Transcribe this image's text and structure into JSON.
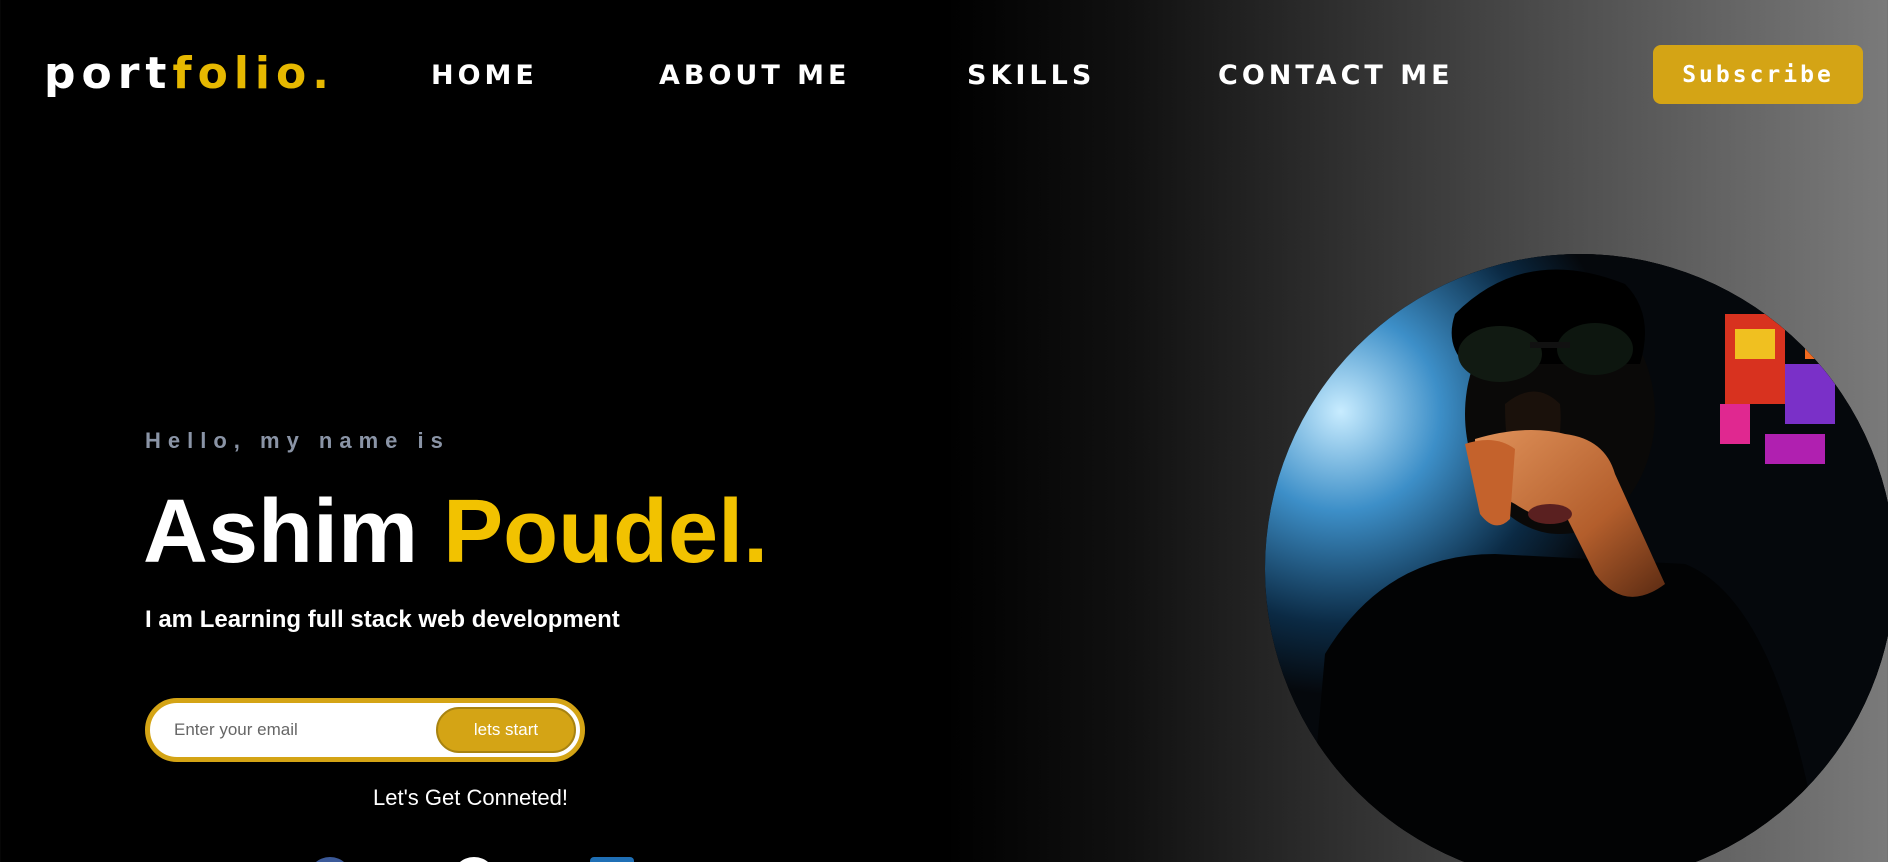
{
  "header": {
    "logo_part1": "port",
    "logo_part2": "folio.",
    "nav": [
      {
        "label": "HOME"
      },
      {
        "label": "ABOUT ME"
      },
      {
        "label": "SKILLS"
      },
      {
        "label": "CONTACT ME"
      }
    ],
    "subscribe_label": "Subscribe"
  },
  "hero": {
    "greeting": "Hello, my name is",
    "first_name": "Ashim",
    "last_name": "Poudel.",
    "tagline": "I am Learning full stack web development",
    "email_placeholder": "Enter your email",
    "start_label": "lets start",
    "connect_text": "Let's Get Conneted!",
    "social_icons": [
      "facebook-icon",
      "github-icon",
      "linkedin-icon"
    ]
  },
  "colors": {
    "accent": "#d4a415",
    "name_accent": "#f2c200",
    "greeting": "#8a94a6"
  }
}
